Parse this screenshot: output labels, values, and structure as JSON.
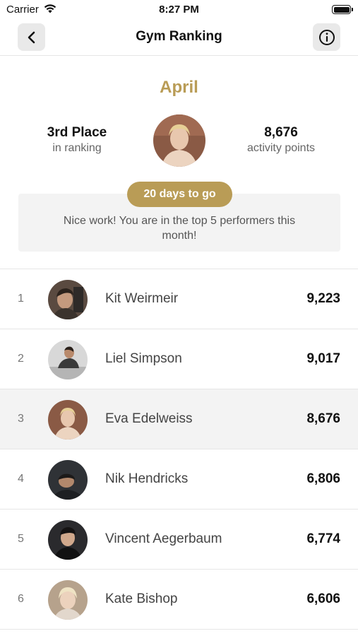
{
  "status_bar": {
    "carrier": "Carrier",
    "time": "8:27 PM"
  },
  "nav": {
    "title": "Gym Ranking",
    "back_icon": "chevron-left-icon",
    "info_icon": "info-circle-icon"
  },
  "summary": {
    "month": "April",
    "place_value": "3rd Place",
    "place_label": "in ranking",
    "points_value": "8,676",
    "points_label": "activity points",
    "days_to_go": "20 days to go",
    "message": "Nice work! You are in the top 5 performers this month!",
    "accent_color": "#b99c56"
  },
  "ranking": [
    {
      "rank": "1",
      "name": "Kit Weirmeir",
      "points": "9,223"
    },
    {
      "rank": "2",
      "name": "Liel Simpson",
      "points": "9,017"
    },
    {
      "rank": "3",
      "name": "Eva Edelweiss",
      "points": "8,676",
      "current": true
    },
    {
      "rank": "4",
      "name": "Nik Hendricks",
      "points": "6,806"
    },
    {
      "rank": "5",
      "name": "Vincent Aegerbaum",
      "points": "6,774"
    },
    {
      "rank": "6",
      "name": "Kate Bishop",
      "points": "6,606"
    }
  ]
}
